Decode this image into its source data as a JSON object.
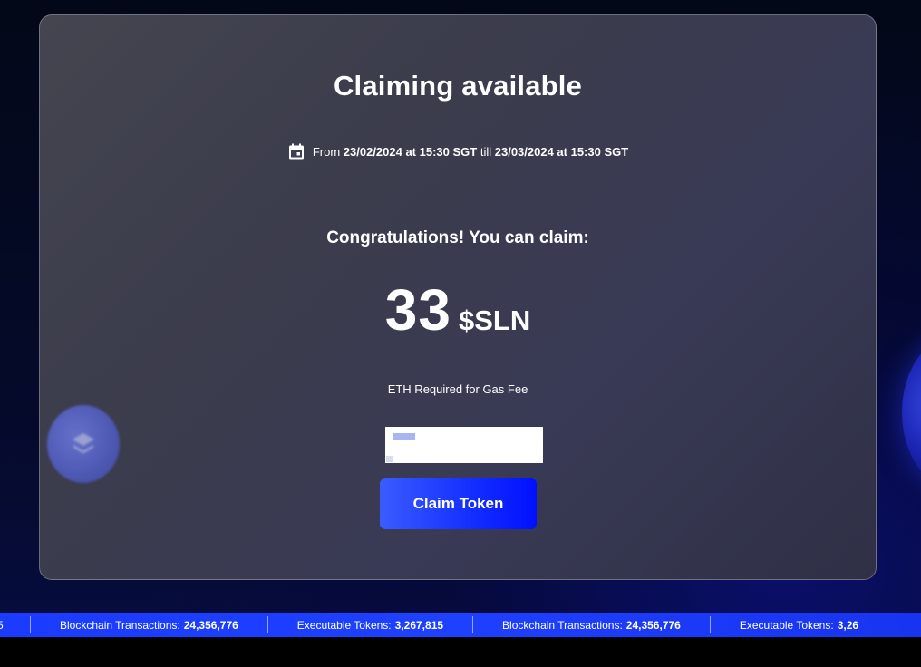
{
  "card": {
    "title": "Claiming available",
    "period": {
      "from_label": "From",
      "start": "23/02/2024 at 15:30 SGT",
      "till_label": "till",
      "end": "23/03/2024 at 15:30 SGT"
    },
    "congrats": "Congratulations! You can claim:",
    "amount": "33",
    "ticker": "$SLN",
    "gas_label": "ETH Required for Gas Fee",
    "claim_button": "Claim Token"
  },
  "ticker_bar": {
    "partial_start": "5",
    "items": [
      {
        "label": "Blockchain Transactions:",
        "value": "24,356,776"
      },
      {
        "label": "Executable Tokens:",
        "value": "3,267,815"
      },
      {
        "label": "Blockchain Transactions:",
        "value": "24,356,776"
      },
      {
        "label": "Executable Tokens:",
        "value": "3,26"
      }
    ]
  },
  "colors": {
    "accent": "#1631ff",
    "card_bg": "#3b3c4c",
    "ticker_bg": "#1e40ff"
  },
  "icons": {
    "calendar": "calendar-icon",
    "coin": "layers-coin-icon"
  }
}
